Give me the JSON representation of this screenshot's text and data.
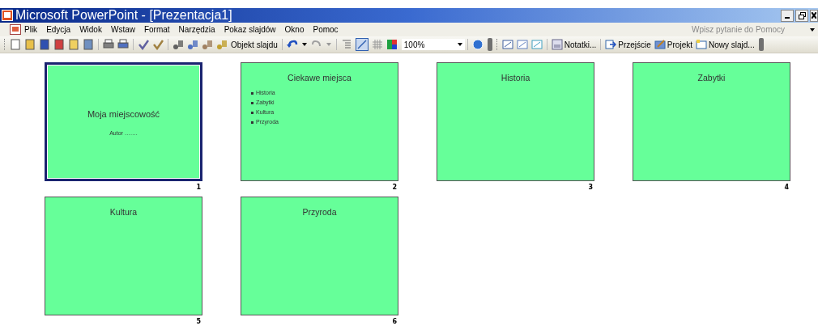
{
  "window": {
    "title": "Microsoft PowerPoint - [Prezentacja1]"
  },
  "menu": [
    "Plik",
    "Edycja",
    "Widok",
    "Wstaw",
    "Format",
    "Narzędzia",
    "Pokaz slajdów",
    "Okno",
    "Pomoc"
  ],
  "help_box": {
    "placeholder": "Wpisz pytanie do Pomocy"
  },
  "toolbar": {
    "object_button": "Objekt slajdu",
    "zoom": "100%",
    "notes_button": "Notatki...",
    "transition_button": "Przejście",
    "design_button": "Projekt",
    "new_slide_button": "Nowy slajd..."
  },
  "slides": [
    {
      "number": "1",
      "kind": "title",
      "selected": true,
      "title": "Moja miejscowość",
      "subtitle": "Autor ……."
    },
    {
      "number": "2",
      "kind": "content",
      "selected": false,
      "title": "Ciekawe miejsca",
      "bullets": [
        "Historia",
        "Zabytki",
        "Kultura",
        "Przyroda"
      ]
    },
    {
      "number": "3",
      "kind": "content",
      "selected": false,
      "title": "Historia"
    },
    {
      "number": "4",
      "kind": "content",
      "selected": false,
      "title": "Zabytki"
    },
    {
      "number": "5",
      "kind": "content",
      "selected": false,
      "title": "Kultura"
    },
    {
      "number": "6",
      "kind": "content",
      "selected": false,
      "title": "Przyroda"
    }
  ]
}
